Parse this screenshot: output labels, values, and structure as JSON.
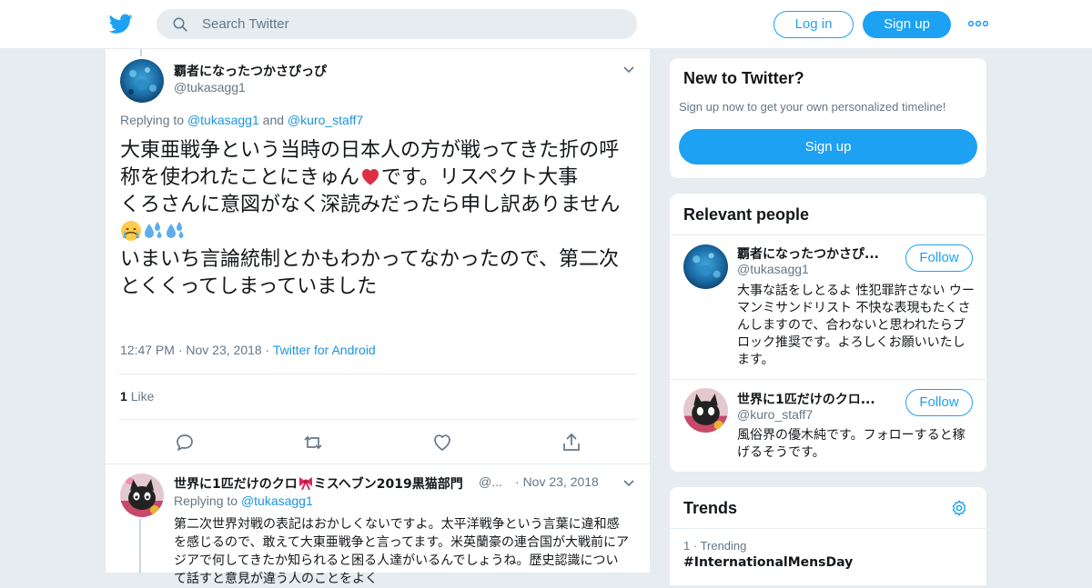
{
  "topbar": {
    "search_placeholder": "Search Twitter",
    "login_label": "Log in",
    "signup_label": "Sign up",
    "logo_icon": "twitter-bird-icon",
    "brand_color": "#1da1f2"
  },
  "tweet": {
    "name": "覇者になったつかさぴっぴ",
    "handle": "@tukasagg1",
    "replying_prefix": "Replying to",
    "replying_to_1": "@tukasagg1",
    "replying_and": "and",
    "replying_to_2": "@kuro_staff7",
    "line1": "大東亜戦争という当時の日本人の方が戦ってきた折の呼称を使われたことにきゅん",
    "line1_tail": "です。リスペクト大事",
    "line2": "くろさんに意図がなく深読みだったら申し訳ありません",
    "line3": "いまいち言論統制とかもわかってなかったので、第二次とくくってしまっていました",
    "time": "12:47 PM",
    "date": "Nov 23, 2018",
    "source": "Twitter for Android",
    "like_count": "1",
    "like_label": "Like",
    "emojis": [
      "red-heart-icon",
      "crying-face-icon",
      "sweat-droplets-icon",
      "sweat-droplets-icon"
    ]
  },
  "reply": {
    "name": "世界に1匹だけのクロ",
    "name_tail": "ミスヘブン2019黒猫部門",
    "handle_trunc": "@...",
    "date": "Nov 23, 2018",
    "replying_prefix": "Replying to",
    "replying_to": "@tukasagg1",
    "text": "第二次世界対戦の表記はおかしくないですよ。太平洋戦争という言葉に違和感を感じるので、敢えて大東亜戦争と言ってます。米英蘭豪の連合国が大戦前にアジアで何してきたか知られると困る人達がいるんでしょうね。歴史認識について話すと意見が違う人のことをよく"
  },
  "new_to_twitter": {
    "title": "New to Twitter?",
    "subtitle": "Sign up now to get your own personalized timeline!",
    "button": "Sign up"
  },
  "relevant": {
    "title": "Relevant people",
    "people": [
      {
        "name": "覇者になったつかさぴ...",
        "handle": "@tukasagg1",
        "follow": "Follow",
        "bio": "大事な話をしとるよ 性犯罪許さない ウーマンミサンドリスト 不快な表現もたくさんしますので、合わないと思われたらブロック推奨です。よろしくお願いいたします。"
      },
      {
        "name": "世界に1匹だけのクロ...",
        "handle": "@kuro_staff7",
        "follow": "Follow",
        "bio": "風俗界の優木純です。フォローすると稼げるそうです。"
      }
    ]
  },
  "trends": {
    "title": "Trends",
    "items": [
      {
        "rank": "1",
        "label": "Trending",
        "name": "#InternationalMensDay"
      }
    ]
  }
}
